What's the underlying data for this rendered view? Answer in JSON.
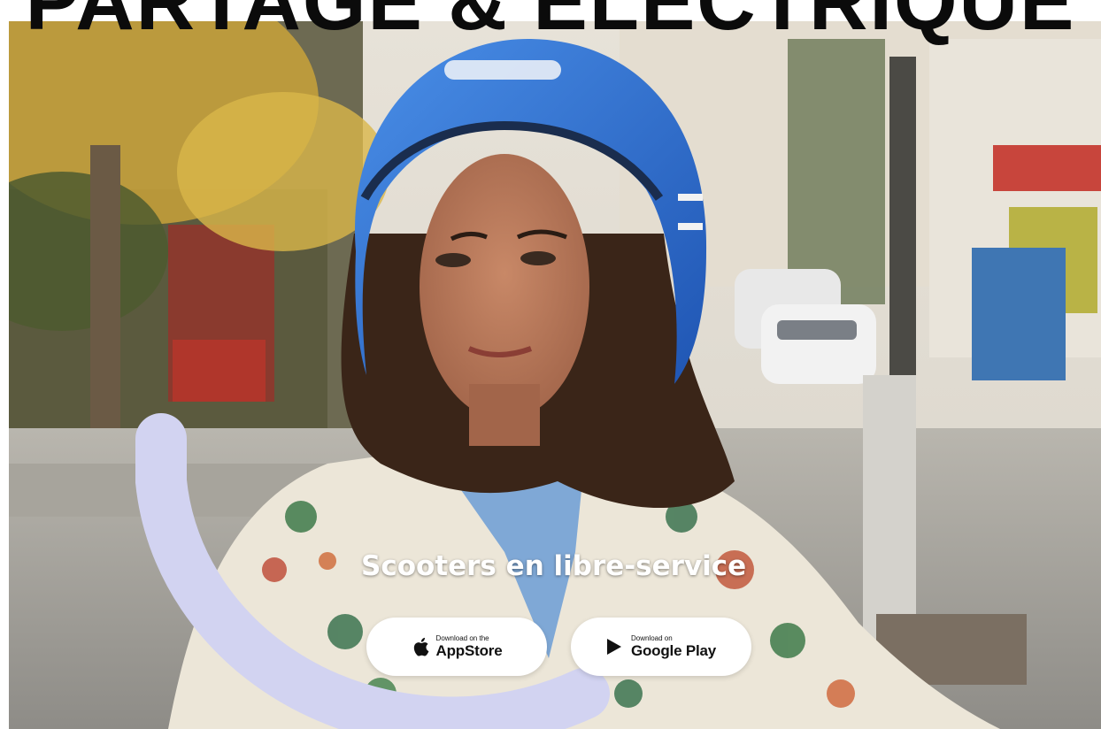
{
  "hero": {
    "headline": "PARTAGE & ÉLECTRIQUE",
    "tagline": "Scooters en libre-service"
  },
  "stores": {
    "appstore": {
      "small": "Download on the",
      "big": "AppStore",
      "icon": "apple-icon"
    },
    "googleplay": {
      "small": "Download on",
      "big": "Google Play",
      "icon": "play-triangle-icon"
    }
  },
  "colors": {
    "headline": "#0b0b0b",
    "arc": "#d2d3f1",
    "helmet": "#2f6fd0",
    "button_bg": "#ffffff",
    "tagline": "#ffffff"
  }
}
